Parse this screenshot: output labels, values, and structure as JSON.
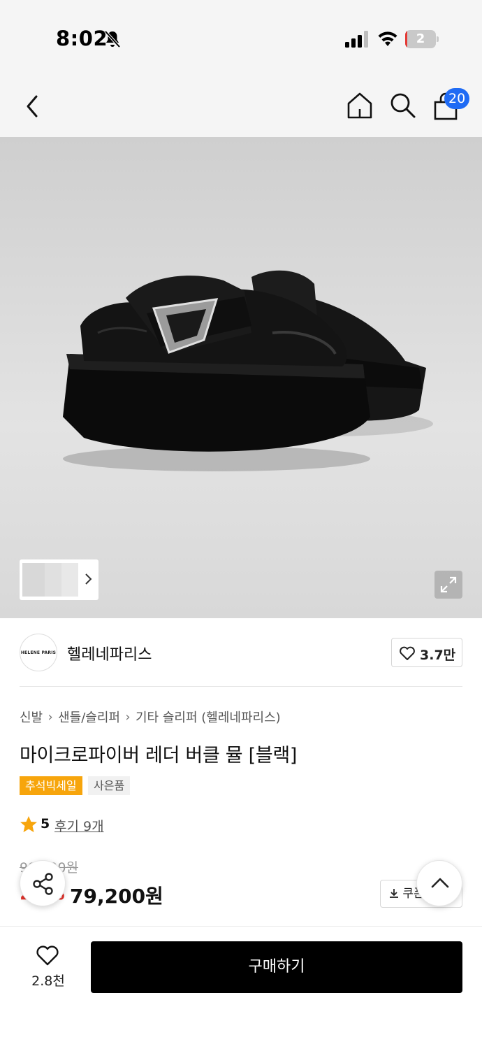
{
  "status_bar": {
    "time": "8:02",
    "battery": "2",
    "battery_level": 0.02
  },
  "nav": {
    "cart_count": "20",
    "icons": [
      "back-chevron-icon",
      "home-icon",
      "search-icon",
      "shopping-bag-icon"
    ]
  },
  "gallery": {
    "thumbnail_count": 3
  },
  "brand": {
    "logo_text": "HELENE PARIS",
    "name": "헬레네파리스",
    "likes": "3.7만"
  },
  "breadcrumb": [
    "신발",
    "샌들/슬리퍼",
    "기타 슬리퍼 (헬레네파리스)"
  ],
  "product": {
    "title": "마이크로파이버 레더 버클 뮬 [블랙]",
    "badges": [
      "추석빅세일",
      "사은품"
    ],
    "rating": "5",
    "review_link": "후기 9개",
    "original_price": "99,000원",
    "discount_rate": "20%",
    "sale_price": "79,200원",
    "coupon_label": "쿠폰"
  },
  "bottom": {
    "wish_count": "2.8천",
    "buy_label": "구매하기"
  },
  "colors": {
    "badge_sale": "#f7a50c",
    "discount": "#e4322b",
    "cart_badge": "#1f6bf4",
    "buy_button": "#000000"
  }
}
